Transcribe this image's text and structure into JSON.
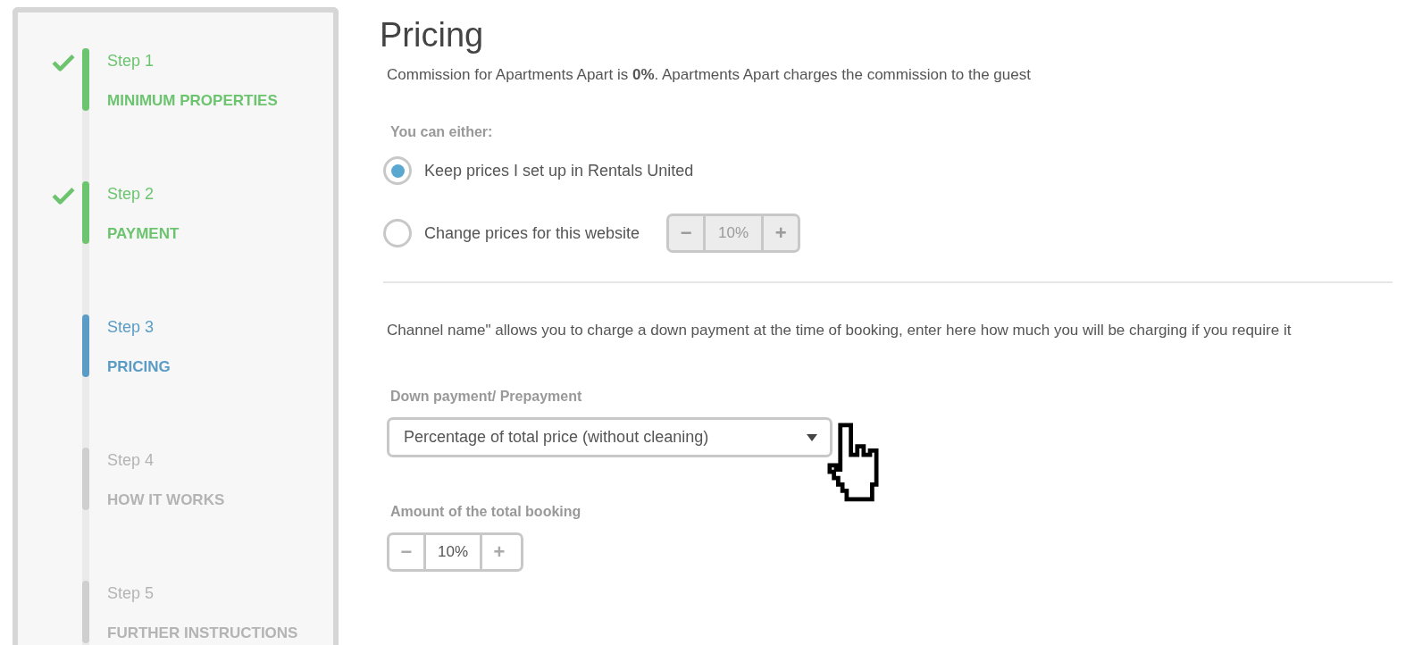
{
  "steps": [
    {
      "label": "Step 1",
      "title": "MINIMUM PROPERTIES",
      "completed": true,
      "selected": false
    },
    {
      "label": "Step 2",
      "title": "PAYMENT",
      "completed": true,
      "selected": false
    },
    {
      "label": "Step 3",
      "title": "PRICING",
      "completed": false,
      "selected": true
    },
    {
      "label": "Step 4",
      "title": "HOW IT WORKS",
      "completed": false,
      "selected": false
    },
    {
      "label": "Step 5",
      "title": "FURTHER INSTRUCTIONS",
      "completed": false,
      "selected": false
    }
  ],
  "heading": "Pricing",
  "commission": "Commission for Apartments Apart is **0%**.  Apartments Apart charges the commission to the guest",
  "options_label": "You can either:",
  "options": [
    {
      "label": "Keep prices I set up in Rentals United",
      "selected": true
    },
    {
      "label": "Change prices for this website",
      "selected": false,
      "stepper": {
        "minus": "−",
        "value": "10%",
        "plus": "+",
        "disabled": true
      }
    }
  ],
  "down_payment_note": "Channel name\" allows you to charge a down payment at the time of booking, enter here how much you will be charging if you require it",
  "down_payment": {
    "label": "Down payment/ Prepayment",
    "value": "Percentage of total price (without cleaning)"
  },
  "amount": {
    "label": "Amount of the total booking",
    "stepper": {
      "minus": "−",
      "value": "10%",
      "plus": "+",
      "disabled": false
    }
  }
}
